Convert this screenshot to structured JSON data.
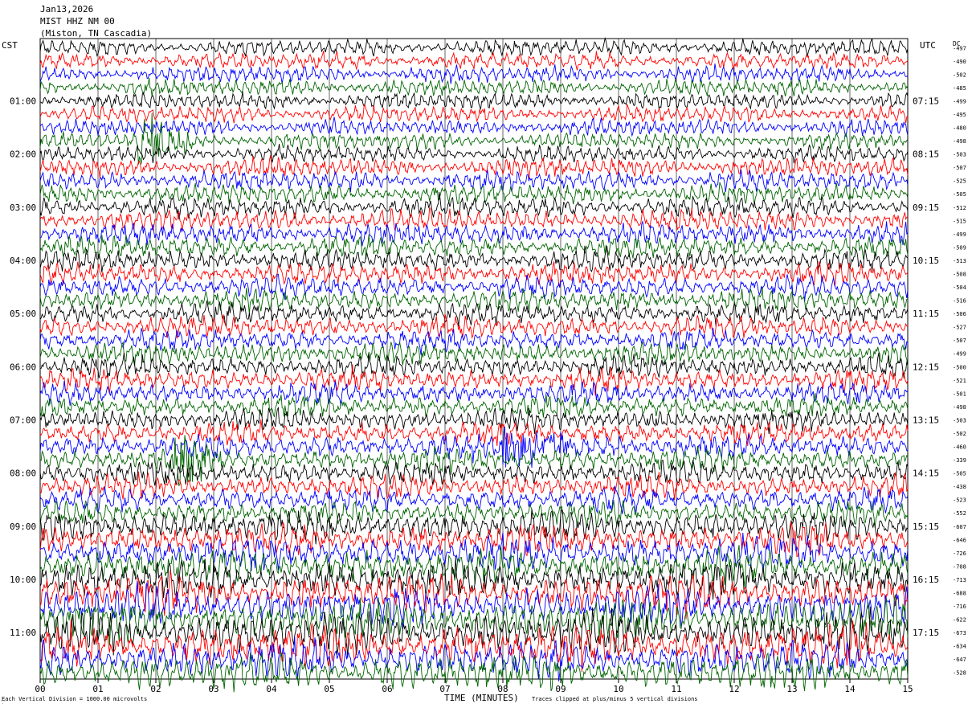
{
  "header": {
    "date": "Jan13,2026",
    "station": "MIST HHZ NM 00",
    "location": "(Miston, TN Cascadia)"
  },
  "left_tz_label": "CST",
  "right_tz_label": "UTC",
  "dc_label": "DC",
  "footer": {
    "scale_note": "Each Vertical Division = 1000.00 microvolts",
    "xlabel": "TIME (MINUTES)",
    "clip_note": "Traces clipped at plus/minus 5 vertical divisions"
  },
  "colors": {
    "black": "#000000",
    "red": "#ff0000",
    "blue": "#0000ff",
    "green": "#006400"
  },
  "chart_data": {
    "type": "line",
    "title": "MIST HHZ NM 00",
    "xlabel": "TIME (MINUTES)",
    "xlim": [
      0,
      15
    ],
    "x_ticks": [
      "00",
      "01",
      "02",
      "03",
      "04",
      "05",
      "06",
      "07",
      "08",
      "09",
      "10",
      "11",
      "12",
      "13",
      "14",
      "15"
    ],
    "trace_colors_cycle": [
      "black",
      "red",
      "blue",
      "green"
    ],
    "trace_count": 48,
    "left_hour_labels": [
      "01:00",
      "02:00",
      "03:00",
      "04:00",
      "05:00",
      "06:00",
      "07:00",
      "08:00",
      "09:00",
      "10:00",
      "11:00"
    ],
    "right_hour_labels": [
      "07:15",
      "08:15",
      "09:15",
      "10:15",
      "11:15",
      "12:15",
      "13:15",
      "14:15",
      "15:15",
      "16:15",
      "17:15"
    ],
    "dc_offsets": [
      -497,
      -490,
      -502,
      -485,
      -499,
      -495,
      -480,
      -498,
      -503,
      -507,
      -525,
      -505,
      -512,
      -515,
      -499,
      -509,
      -513,
      -508,
      -504,
      -516,
      -506,
      -527,
      -507,
      -499,
      -500,
      -521,
      -501,
      -498,
      -503,
      -502,
      -460,
      -339,
      -505,
      -438,
      -523,
      -552,
      -607,
      -646,
      -726,
      -708,
      -713,
      -688,
      -716,
      -622,
      -673,
      -634,
      -647,
      -528
    ],
    "trace_amplitude_levels": [
      1,
      1,
      1,
      1,
      1,
      1,
      1,
      1,
      1,
      1.2,
      1.2,
      1.2,
      1.3,
      1.3,
      1.3,
      1.3,
      1.3,
      1.3,
      1.3,
      1.3,
      1.3,
      1.3,
      1.3,
      1.3,
      1.3,
      1.3,
      1.3,
      1.3,
      1.3,
      1.3,
      1.4,
      1.4,
      1.4,
      1.4,
      1.4,
      1.4,
      1.8,
      1.8,
      2.0,
      2.0,
      2.2,
      2.2,
      2.3,
      2.3,
      2.4,
      2.4,
      2.2,
      2.2
    ],
    "events": [
      {
        "trace": 7,
        "minute": 1.7,
        "duration": 1.2,
        "strength": 3
      },
      {
        "trace": 30,
        "minute": 8.0,
        "duration": 2.0,
        "strength": 2.5
      },
      {
        "trace": 31,
        "minute": 2.3,
        "duration": 1.2,
        "strength": 3
      }
    ]
  }
}
